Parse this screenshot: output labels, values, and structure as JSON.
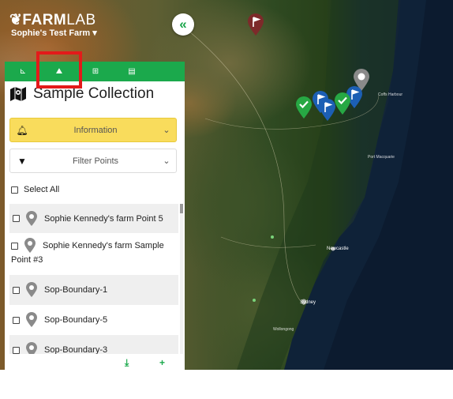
{
  "app": {
    "brand_bold": "FARM",
    "brand_light": "LAB",
    "farm_name": "Sophie's Test Farm ▾"
  },
  "toolbar": {
    "collapse_glyph": "«"
  },
  "tabs": [
    {
      "icon": "ruler-icon",
      "glyph": "⊾"
    },
    {
      "icon": "sample-collection-icon",
      "glyph": "⛰"
    },
    {
      "icon": "points-icon",
      "glyph": "⊞"
    },
    {
      "icon": "document-icon",
      "glyph": "▤"
    }
  ],
  "panel": {
    "title": "Sample Collection",
    "information_label": "Information",
    "filter_label": "Filter Points",
    "select_all_label": "Select All"
  },
  "points": [
    {
      "label": "Sophie Kennedy's farm Point 5"
    },
    {
      "label": "Sophie Kennedy's farm Sample Point #3"
    },
    {
      "label": "Sop-Boundary-1"
    },
    {
      "label": "Sop-Boundary-5"
    },
    {
      "label": "Sop-Boundary-3"
    }
  ],
  "footer": {
    "download_glyph": "⤓",
    "add_glyph": "+"
  },
  "map": {
    "places": {
      "newcastle": "Newcastle",
      "sydney": "Sydney",
      "port_macquarie": "Port Macquarie",
      "coffs_harbour": "Coffs Harbour",
      "wollongong": "Wollongong"
    },
    "colors": {
      "flag_red": "#7d2a2a",
      "flag_blue": "#1c5fb4",
      "check_green": "#27a844",
      "grey": "#8a8a8a"
    }
  }
}
